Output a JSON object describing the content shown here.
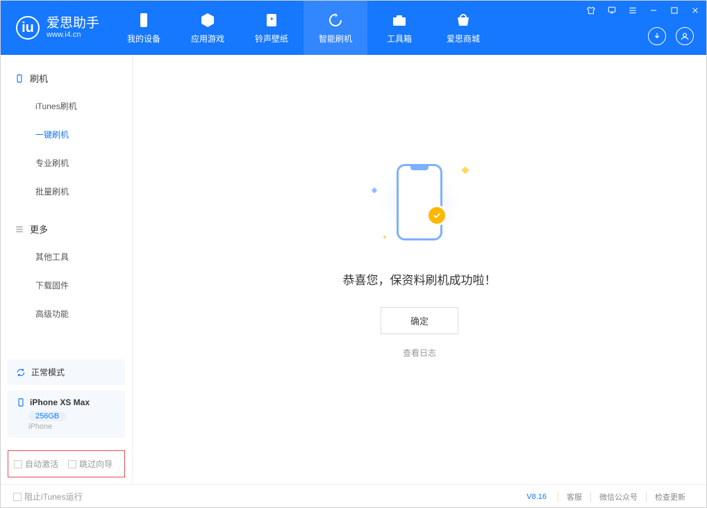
{
  "header": {
    "app_title": "爱思助手",
    "app_url": "www.i4.cn",
    "tabs": [
      "我的设备",
      "应用游戏",
      "铃声壁纸",
      "智能刷机",
      "工具箱",
      "爱思商城"
    ],
    "active_tab_index": 3
  },
  "sidebar": {
    "group1_label": "刷机",
    "group1_items": [
      "iTunes刷机",
      "一键刷机",
      "专业刷机",
      "批量刷机"
    ],
    "group1_active_index": 1,
    "group2_label": "更多",
    "group2_items": [
      "其他工具",
      "下载固件",
      "高级功能"
    ],
    "status_label": "正常模式",
    "device_name": "iPhone XS Max",
    "device_capacity": "256GB",
    "device_type": "iPhone",
    "checkbox1": "自动激活",
    "checkbox2": "跳过向导"
  },
  "main": {
    "success_msg": "恭喜您，保资料刷机成功啦！",
    "ok_button": "确定",
    "log_link": "查看日志"
  },
  "footer": {
    "stop_itunes": "阻止iTunes运行",
    "version": "V8.16",
    "links": [
      "客服",
      "微信公众号",
      "检查更新"
    ]
  }
}
